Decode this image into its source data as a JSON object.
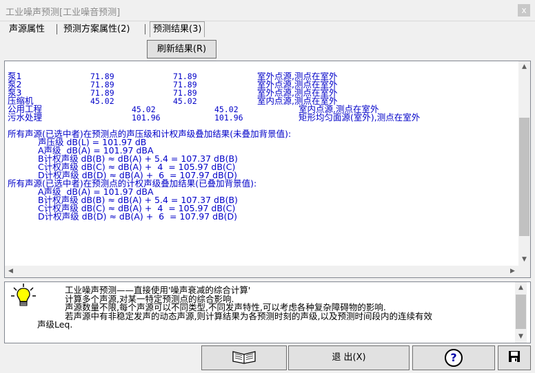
{
  "window": {
    "title": "工业噪声预测[工业噪音预测]",
    "close_label": "x"
  },
  "tabs": [
    {
      "label": "声源属性"
    },
    {
      "label": "预测方案属性(2)"
    },
    {
      "label": "预测结果(3)"
    }
  ],
  "refresh_label": "刷新结果(R)",
  "results": [
    {
      "name": "泵1",
      "v1": "71.89",
      "v2": "71.89",
      "desc": "室外点源,测点在室外"
    },
    {
      "name": "泵2",
      "v1": "71.89",
      "v2": "71.89",
      "desc": "室外点源,测点在室外"
    },
    {
      "name": "泵3",
      "v1": "71.89",
      "v2": "71.89",
      "desc": "室外点源,测点在室外"
    },
    {
      "name": "压缩机",
      "v1": "45.02",
      "v2": "45.02",
      "desc": "室内点源,测点在室外"
    },
    {
      "name": "公用工程",
      "v1": "45.02",
      "v2": "45.02",
      "desc": "室内点源,测点在室外"
    },
    {
      "name": "污水处理",
      "v1": "101.96",
      "v2": "101.96",
      "desc": "矩形均匀面源(室外),测点在室外"
    }
  ],
  "summary1": {
    "heading": "所有声源(已选中者)在预测点的声压级和计权声级叠加结果(未叠加背景值):",
    "lines": [
      "声压级 dB(L) = 101.97 dB",
      "A声级  dB(A) = 101.97 dBA",
      "B计权声级 dB(B) ≈ dB(A) + 5.4 = 107.37 dB(B)",
      "C计权声级 dB(C) ≈ dB(A) +  4  = 105.97 dB(C)",
      "D计权声级 dB(D) ≈ dB(A) +  6  = 107.97 dB(D)"
    ]
  },
  "summary2": {
    "heading": "所有声源(已选中者)在预测点的计权声级叠加结果(已叠加背景值):",
    "lines": [
      "A声级  dB(A) = 101.97 dBA",
      "B计权声级 dB(B) ≈ dB(A) + 5.4 = 107.37 dB(B)",
      "C计权声级 dB(C) ≈ dB(A) +  4  = 105.97 dB(C)",
      "D计权声级 dB(D) ≈ dB(A) +  6  = 107.97 dB(D)"
    ]
  },
  "help": {
    "line1": "工业噪声预测——直接使用'噪声衰减的综合计算'",
    "line2": "计算多个声源,对某一特定预测点的综合影响.",
    "line3": "声源数量不限,每个声源可以不同类型,不同发声特性,可以考虑各种复杂障碍物的影响.",
    "line4": "若声源中有非稳定发声的动态声源,则计算结果为各预测时刻的声级,以及预测时间段内的连续有效",
    "line5": "声级Leq."
  },
  "buttons": {
    "exit_label": "退 出(X)",
    "help_label": "?"
  },
  "icons": {
    "bulb": "lightbulb-icon",
    "book": "book-icon",
    "save": "save-icon"
  }
}
